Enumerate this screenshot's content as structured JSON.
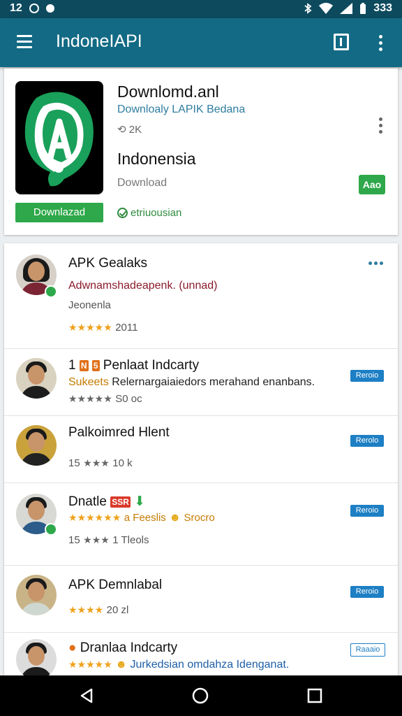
{
  "status_bar": {
    "left_text": "12",
    "right_text": "333"
  },
  "app_bar": {
    "title": "IndoneIAPI"
  },
  "featured": {
    "title": "Downlomd.anl",
    "subtitle": "Downloaly LAPIK Bedana",
    "count": "2K",
    "name": "Indonensia",
    "download_text": "Download",
    "download_button": "Downlazad",
    "verified_text": "etriuousian",
    "add_button": "Aao",
    "logo_letter": "A"
  },
  "list": [
    {
      "title": "APK Gealaks",
      "line1": "Adwnamshadeapenk. (unnad)",
      "line2": "Jeonenla",
      "stars": "★★★★★",
      "meta": "2011",
      "action": "more",
      "avatar_color": "#7b2433"
    },
    {
      "title": "Penlaat Indcarty",
      "prefix_tags": [
        "1",
        "N",
        "5"
      ],
      "line1_a": "Sukeets",
      "line1_b": "Relernargaiaiedors merahand enanbans.",
      "stars": "★★★★★",
      "meta": "S0 oc",
      "action": "Reroio",
      "avatar_color": "#1d1d1d"
    },
    {
      "title": "Palkoimred Hlent",
      "stars": "★★★",
      "stars_prefix": "15",
      "meta": "10 k",
      "action": "Rerolo",
      "avatar_color": "#222222"
    },
    {
      "title": "Dnatle",
      "tag": "SSR",
      "line1_a": "★★★★★★",
      "line1_b": "a Feeslis",
      "line1_c": "Srocro",
      "stars": "★★★",
      "stars_prefix": "15",
      "meta": "1 Tleols",
      "action": "Reroio",
      "avatar_color": "#2b5c8a"
    },
    {
      "title": "APK Demnlabal",
      "stars": "★★★★",
      "meta": "20 zl",
      "action": "Reroio",
      "avatar_color": "#cfd8d0"
    },
    {
      "title": "Dranlaa Indcarty",
      "line1_a": "★★★★★",
      "line1_b": "Jurkedsian omdahza Idenganat.",
      "action": "Raaaio",
      "avatar_color": "#1b1b1b"
    }
  ],
  "colors": {
    "appbar": "#136a84",
    "statusbar": "#0d4a5e",
    "accent_green": "#2ea84a",
    "accent_blue": "#1d7fc4"
  },
  "icons": [
    "menu-icon",
    "square-icon",
    "more-vert-icon",
    "bluetooth-icon",
    "wifi-icon",
    "signal-icon",
    "battery-icon",
    "back-icon",
    "home-icon",
    "recents-icon"
  ]
}
